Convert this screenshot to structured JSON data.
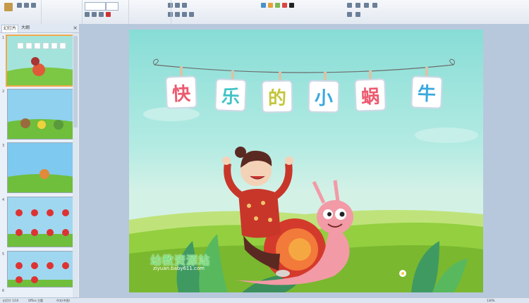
{
  "sidebar": {
    "tabs": [
      {
        "label": "幻灯片"
      },
      {
        "label": "大纲"
      }
    ],
    "close_glyph": "×",
    "thumbnails": [
      {
        "number": "1"
      },
      {
        "number": "2"
      },
      {
        "number": "3"
      },
      {
        "number": "4"
      },
      {
        "number": "5"
      },
      {
        "number": "6"
      }
    ]
  },
  "slide": {
    "title_chars": [
      "快",
      "乐",
      "的",
      "小",
      "蜗",
      "牛"
    ],
    "title_colors": [
      "#ec5a6e",
      "#42c3c6",
      "#c3c63a",
      "#3aa8de",
      "#ec5a6e",
      "#3aa8de"
    ],
    "watermark_logo": "幼教资源站",
    "watermark_url": "ziyuan.baby611.com"
  },
  "statusbar": {
    "slide_info": "幻灯片 1/10",
    "theme": "Office 主题",
    "language": "中文(中国)",
    "zoom": "130%"
  }
}
